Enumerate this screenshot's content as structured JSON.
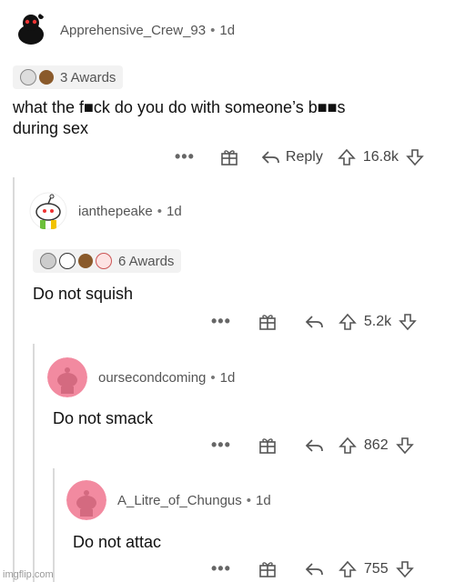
{
  "comments": [
    {
      "username": "Apprehensive_Crew_93",
      "age": "1d",
      "awards_label": "3 Awards",
      "body_line1": "what the f■ck do you do with someone’s b■■s",
      "body_line2": "during sex",
      "reply_label": "Reply",
      "score": "16.8k"
    },
    {
      "username": "ianthepeake",
      "age": "1d",
      "awards_label": "6 Awards",
      "body": "Do not squish",
      "score": "5.2k"
    },
    {
      "username": "oursecondcoming",
      "age": "1d",
      "body": "Do not smack",
      "score": "862"
    },
    {
      "username": "A_Litre_of_Chungus",
      "age": "1d",
      "body": "Do not attac",
      "score": "755"
    }
  ],
  "separator": "•",
  "more_label": "•••",
  "watermark": "imgflip.com",
  "colors": {
    "avatar_pink": "#f28aa0",
    "thread_line": "#dadada",
    "award_bg": "#f2f2f2"
  }
}
